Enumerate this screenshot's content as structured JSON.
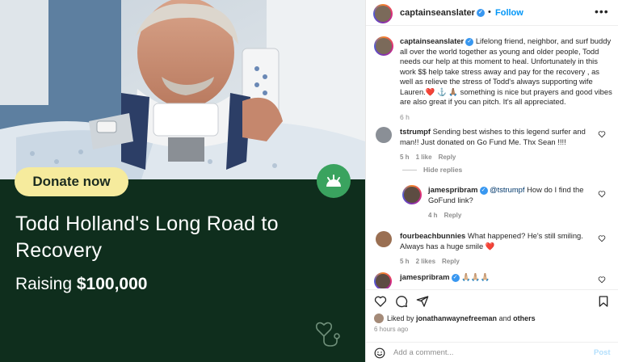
{
  "promo": {
    "donate_label": "Donate now",
    "title": "Todd Holland's Long Road to Recovery",
    "raising_prefix": "Raising ",
    "raising_amount": "$100,000",
    "badge_color": "#3aa35f",
    "panel_color": "#0f2e1d"
  },
  "header": {
    "username": "captainseanslater",
    "separator": "•",
    "follow_label": "Follow",
    "more_label": "•••"
  },
  "caption": {
    "username": "captainseanslater",
    "text": " Lifelong friend, neighbor, and surf buddy all over the world together as young and older people, Todd needs our help at this moment to heal. Unfortunately in this work $$ help take stress away and pay for the recovery , as well as relieve the stress of Todd's always supporting wife Lauren.❤️ ⚓ 🙏🏽 something is nice but prayers and good vibes are also great if you can pitch. It's all appreciated.",
    "time": "6 h"
  },
  "comments": [
    {
      "username": "tstrumpf",
      "text": "Sending best wishes to this legend surfer and man!! Just donated on Go Fund Me. Thx Sean !!!!",
      "time": "5 h",
      "likes": "1 like",
      "reply": "Reply"
    },
    {
      "username": "jamespribram",
      "mention": "@tstrumpf",
      "text": " How do I find the GoFund link?",
      "time": "4 h",
      "reply": "Reply"
    },
    {
      "username": "fourbeachbunnies",
      "text": "What happened? He's still smiling. Always has a huge smile ❤️",
      "time": "5 h",
      "likes": "2 likes",
      "reply": "Reply"
    },
    {
      "username": "jamespribram",
      "text": "🙏🏼🙏🏼🙏🏼"
    }
  ],
  "hide_replies": "Hide replies",
  "liked_by": {
    "prefix": "Liked by ",
    "user": "jonathanwaynefreeman",
    "and": " and ",
    "others": "others"
  },
  "posted_ago": "6 hours ago",
  "add_comment": {
    "placeholder": "Add a comment...",
    "post_label": "Post"
  },
  "icons": [
    "heart-icon",
    "comment-icon",
    "share-icon",
    "bookmark-icon",
    "emoji-icon",
    "more-icon",
    "verified-icon",
    "gofundme-logo-icon",
    "heart-stethoscope-icon"
  ]
}
